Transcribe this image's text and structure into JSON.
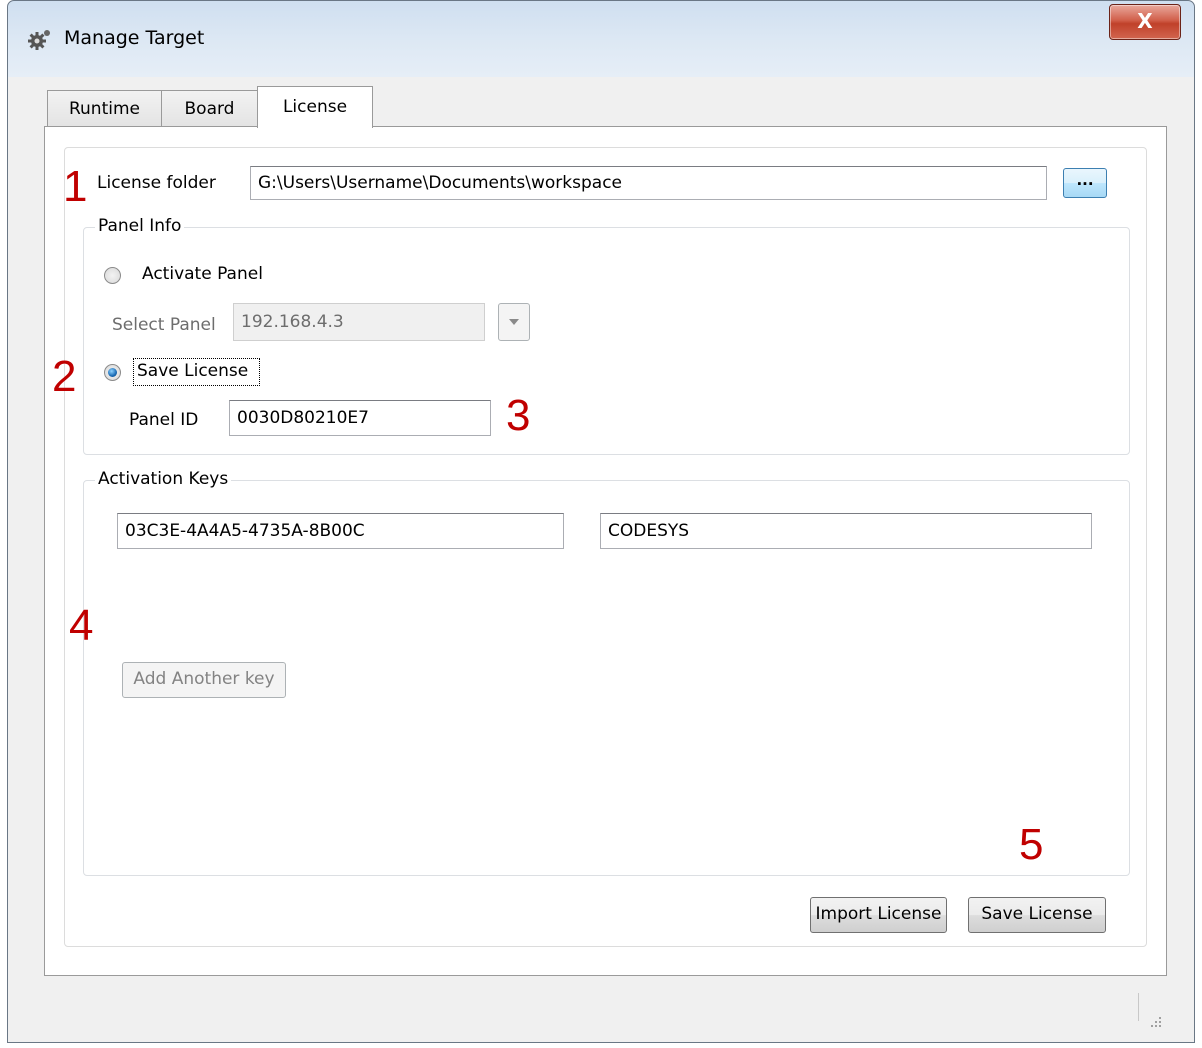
{
  "window": {
    "title": "Manage Target",
    "close_label": "X"
  },
  "tabs": [
    {
      "label": "Runtime"
    },
    {
      "label": "Board"
    },
    {
      "label": "License"
    }
  ],
  "license_folder": {
    "label": "License folder",
    "value": "G:\\Users\\Username\\Documents\\workspace",
    "browse_label": "..."
  },
  "panel_info": {
    "title": "Panel Info",
    "activate_label": "Activate Panel",
    "select_panel_label": "Select Panel",
    "select_panel_value": "192.168.4.3",
    "save_license_label": "Save License",
    "panel_id_label": "Panel ID",
    "panel_id_value": "0030D80210E7"
  },
  "activation_keys": {
    "title": "Activation Keys",
    "key_value": "03C3E-4A4A5-4735A-8B00C",
    "product_value": "CODESYS",
    "add_key_label": "Add Another key"
  },
  "footer": {
    "import_label": "Import License",
    "save_label": "Save License"
  },
  "annotations": [
    "1",
    "2",
    "3",
    "4",
    "5"
  ],
  "colors": {
    "annotation": "#c00000",
    "close_button": "#c8452f"
  }
}
